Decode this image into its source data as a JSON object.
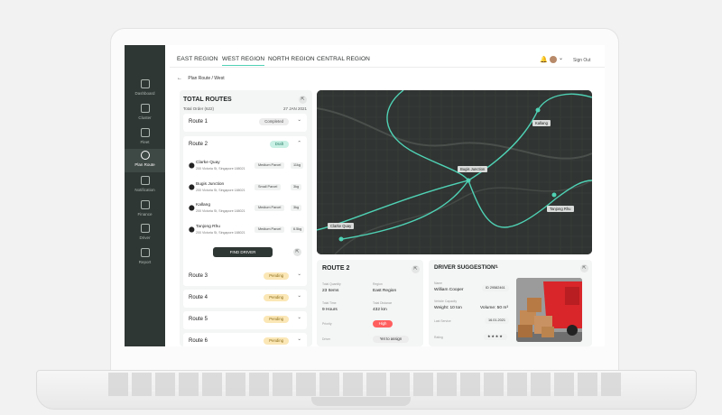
{
  "sidebar": {
    "items": [
      {
        "label": "Dashboard",
        "icon": "dashboard-icon"
      },
      {
        "label": "Cluster",
        "icon": "cluster-icon"
      },
      {
        "label": "Fleet",
        "icon": "truck-icon"
      },
      {
        "label": "Plan Route",
        "icon": "compass-icon",
        "active": true
      },
      {
        "label": "Notification",
        "icon": "notification-icon"
      },
      {
        "label": "Finance",
        "icon": "finance-icon"
      },
      {
        "label": "Driver",
        "icon": "driver-icon"
      },
      {
        "label": "Report",
        "icon": "report-icon"
      }
    ]
  },
  "header": {
    "tabs": [
      "EAST REGION",
      "WEST REGION",
      "NORTH REGION",
      "CENTRAL REGION"
    ],
    "active_tab": "WEST REGION",
    "signout": "Sign Out",
    "bell_glyph": "🔔",
    "chevron_glyph": "⌄"
  },
  "breadcrumb": {
    "arrow": "←",
    "text": "Plan Route / West"
  },
  "routes_panel": {
    "title": "TOTAL ROUTES",
    "subtitle": "Total Order (622)",
    "date": "27 JAN 2021",
    "expand_glyph": "⇱",
    "routes": [
      {
        "name": "Route 1",
        "status": "Completed"
      },
      {
        "name": "Route 2",
        "status": "Draft"
      },
      {
        "name": "Route 3",
        "status": "Pending"
      },
      {
        "name": "Route 4",
        "status": "Pending"
      },
      {
        "name": "Route 5",
        "status": "Pending"
      },
      {
        "name": "Route 6",
        "status": "Pending"
      }
    ],
    "stops": [
      {
        "name": "Clarke Quay",
        "address": "200 Victoria St, Singapore 188021",
        "parcel": "Medium Parcel",
        "weight": "11kg"
      },
      {
        "name": "Bugis Junction",
        "address": "200 Victoria St, Singapore 188021",
        "parcel": "Small Parcel",
        "weight": "3kg"
      },
      {
        "name": "Kallang",
        "address": "200 Victoria St, Singapore 188021",
        "parcel": "Medium Parcel",
        "weight": "3kg"
      },
      {
        "name": "Tanjong Rhu",
        "address": "200 Victoria St, Singapore 188021",
        "parcel": "Medium Parcel",
        "weight": "6.5kg"
      }
    ],
    "find_driver": "FIND DRIVER",
    "chevron_down": "⌄",
    "chevron_up": "⌃"
  },
  "map": {
    "labels": [
      "Kallang",
      "Bugis Junction",
      "Tanjong Rhu",
      "Clarke Quay"
    ],
    "route_color": "#4fd1b4"
  },
  "route_detail": {
    "title": "ROUTE 2",
    "fields": [
      {
        "label": "Total Quantity",
        "value": "23 Items"
      },
      {
        "label": "Region",
        "value": "East Region"
      },
      {
        "label": "Total Time",
        "value": "9 Hours"
      },
      {
        "label": "Total Distance",
        "value": "432 km"
      }
    ],
    "priority_label": "Priority",
    "priority": "High",
    "driver_label": "Driver",
    "driver_status": "Yet to assign"
  },
  "driver_suggestion": {
    "title": "DRIVER SUGGESTION",
    "name_label": "Name",
    "name": "William Cooper",
    "id": "ID 29582461",
    "capacity_label": "Vehicle Capacity",
    "weight": "Weight: 10 ton",
    "volume": "Volume: 50 m³",
    "last_label": "Last Service",
    "last": "16.01.2021",
    "rating_label": "Rating",
    "rating": "★★★★"
  },
  "colors": {
    "accent": "#4fd1b4",
    "sidebar": "#2f3734",
    "high": "#ff5f5f"
  }
}
